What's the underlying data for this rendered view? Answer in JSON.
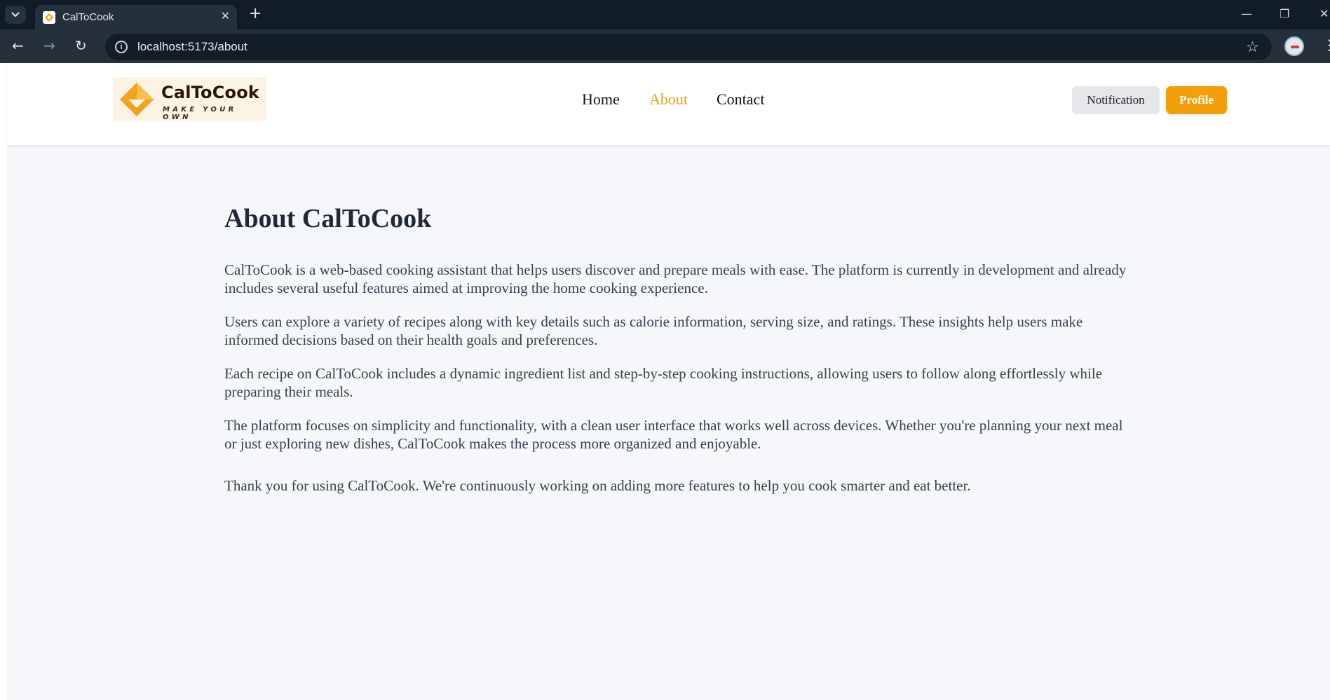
{
  "browser": {
    "tab_title": "CalToCook",
    "url": "localhost:5173/about"
  },
  "navbar": {
    "logo_title": "CalToCook",
    "logo_tagline": "MAKE YOUR OWN",
    "links": [
      {
        "label": "Home",
        "active": false
      },
      {
        "label": "About",
        "active": true
      },
      {
        "label": "Contact",
        "active": false
      }
    ],
    "notification_label": "Notification",
    "profile_label": "Profile",
    "accent_color": "#f59e0b"
  },
  "about": {
    "heading": "About CalToCook",
    "paragraphs": [
      "CalToCook is a web-based cooking assistant that helps users discover and prepare meals with ease. The platform is currently in development and already includes several useful features aimed at improving the home cooking experience.",
      "Users can explore a variety of recipes along with key details such as calorie information, serving size, and ratings. These insights help users make informed decisions based on their health goals and preferences.",
      "Each recipe on CalToCook includes a dynamic ingredient list and step-by-step cooking instructions, allowing users to follow along effortlessly while preparing their meals.",
      "The platform focuses on simplicity and functionality, with a clean user interface that works well across devices. Whether you're planning your next meal or just exploring new dishes, CalToCook makes the process more organized and enjoyable."
    ],
    "closing": "Thank you for using CalToCook. We're continuously working on adding more features to help you cook smarter and eat better."
  }
}
